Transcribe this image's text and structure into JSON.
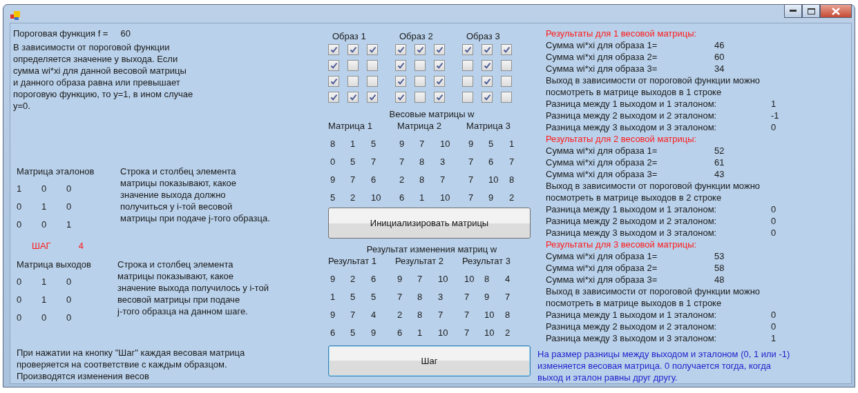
{
  "threshold": {
    "label": "Пороговая функция f =",
    "value": "60"
  },
  "threshold_note": "В зависимости от пороговой функции\nопределяется значение y выхода. Если\nсумма wi*xi для данной весовой матрицы\nи данного образа равна или превышает\nпороговую функцию, то y=1, в ином случае\ny=0.",
  "etalons": {
    "title": "Матрица эталонов",
    "rows": [
      [
        "1",
        "0",
        "0"
      ],
      [
        "0",
        "1",
        "0"
      ],
      [
        "0",
        "0",
        "1"
      ]
    ],
    "note": "Строка и столбец элемента\nматрицы показывают, какое\nзначение выхода должно\nполучиться у i-той весовой\nматрицы при подаче j-того образца."
  },
  "step": {
    "label": "ШАГ",
    "value": "4"
  },
  "outputs": {
    "title": "Матрица выходов",
    "rows": [
      [
        "0",
        "1",
        "0"
      ],
      [
        "0",
        "1",
        "0"
      ],
      [
        "0",
        "0",
        "0"
      ]
    ],
    "note": "Строка и столбец элемента\nматрицы показывают, какое\nзначение выхода получилось у i-той\nвесовой матрицы при подаче\nj-того образца на данном шаге."
  },
  "footer_note": "При нажатии на кнопку \"Шаг\" каждая весовая матрица\nпроверяется на соответствие с каждым образцом.\nПроизводятся изменения весов",
  "images": [
    {
      "title": "Образ 1",
      "cells": [
        [
          true,
          true,
          true
        ],
        [
          true,
          false,
          false
        ],
        [
          true,
          false,
          false
        ],
        [
          true,
          true,
          true
        ]
      ]
    },
    {
      "title": "Образ 2",
      "cells": [
        [
          true,
          true,
          true
        ],
        [
          true,
          false,
          true
        ],
        [
          true,
          false,
          true
        ],
        [
          true,
          false,
          true
        ]
      ]
    },
    {
      "title": "Образ 3",
      "cells": [
        [
          true,
          true,
          true
        ],
        [
          false,
          true,
          false
        ],
        [
          false,
          true,
          false
        ],
        [
          false,
          true,
          false
        ]
      ]
    }
  ],
  "weights": {
    "title": "Весовые матрицы w",
    "matrices": [
      {
        "title": "Матрица 1",
        "rows": [
          [
            "8",
            "1",
            "5"
          ],
          [
            "0",
            "5",
            "7"
          ],
          [
            "9",
            "7",
            "6"
          ],
          [
            "5",
            "2",
            "10"
          ]
        ]
      },
      {
        "title": "Матрица 2",
        "rows": [
          [
            "9",
            "7",
            "10"
          ],
          [
            "7",
            "8",
            "3"
          ],
          [
            "2",
            "8",
            "7"
          ],
          [
            "6",
            "1",
            "10"
          ]
        ]
      },
      {
        "title": "Матрица 3",
        "rows": [
          [
            "9",
            "5",
            "1"
          ],
          [
            "7",
            "6",
            "7"
          ],
          [
            "7",
            "10",
            "8"
          ],
          [
            "7",
            "9",
            "2"
          ]
        ]
      }
    ]
  },
  "init_button": "Инициализировать матрицы",
  "results": {
    "title": "Результат изменения матриц w",
    "matrices": [
      {
        "title": "Результат 1",
        "rows": [
          [
            "9",
            "2",
            "6"
          ],
          [
            "1",
            "5",
            "5"
          ],
          [
            "9",
            "7",
            "4"
          ],
          [
            "6",
            "5",
            "9"
          ]
        ]
      },
      {
        "title": "Результат 2",
        "rows": [
          [
            "9",
            "7",
            "10"
          ],
          [
            "7",
            "8",
            "3"
          ],
          [
            "2",
            "8",
            "7"
          ],
          [
            "6",
            "1",
            "10"
          ]
        ]
      },
      {
        "title": "Результат 3",
        "rows": [
          [
            "10",
            "8",
            "4"
          ],
          [
            "7",
            "9",
            "7"
          ],
          [
            "7",
            "10",
            "8"
          ],
          [
            "7",
            "10",
            "2"
          ]
        ]
      }
    ]
  },
  "step_button": "Шаг",
  "reports": [
    {
      "heading": "Результаты для 1 весовой матрицы:",
      "sums": [
        {
          "label": "Сумма wi*xi для образа 1=",
          "value": "46"
        },
        {
          "label": "Сумма wi*xi для образа 2=",
          "value": "60"
        },
        {
          "label": "Сумма wi*xi для образа 3=",
          "value": "34"
        }
      ],
      "output_note": "Выход в зависимости от пороговой функции можно\nпосмотреть в матрице выходов в 1 строке",
      "diffs": [
        {
          "label": "Разница между 1 выходом и 1 эталоном:",
          "value": "1"
        },
        {
          "label": "Разница между 2 выходом и 2 эталоном:",
          "value": "-1"
        },
        {
          "label": "Разница между 3 выходом и 3 эталоном:",
          "value": "0"
        }
      ]
    },
    {
      "heading": "Результаты для 2 весовой матрицы:",
      "sums": [
        {
          "label": "Сумма wi*xi для образа 1=",
          "value": "52"
        },
        {
          "label": "Сумма wi*xi для образа 2=",
          "value": "61"
        },
        {
          "label": "Сумма wi*xi для образа 3=",
          "value": "43"
        }
      ],
      "output_note": "Выход в зависимости от пороговой функции можно\nпосмотреть в матрице выходов в 2 строке",
      "diffs": [
        {
          "label": "Разница между 1 выходом и 1 эталоном:",
          "value": "0"
        },
        {
          "label": "Разница между 2 выходом и 2 эталоном:",
          "value": "0"
        },
        {
          "label": "Разница между 3 выходом и 3 эталоном:",
          "value": "0"
        }
      ]
    },
    {
      "heading": "Результаты для 3 весовой матрицы:",
      "sums": [
        {
          "label": "Сумма wi*xi для образа 1=",
          "value": "53"
        },
        {
          "label": "Сумма wi*xi для образа 2=",
          "value": "58"
        },
        {
          "label": "Сумма wi*xi для образа 3=",
          "value": "48"
        }
      ],
      "output_note": "Выход в зависимости от пороговой функции можно\nпосмотреть в матрице выходов в 1 строке",
      "diffs": [
        {
          "label": "Разница между 1 выходом и 1 эталоном:",
          "value": "0"
        },
        {
          "label": "Разница между 2 выходом и 2 эталоном:",
          "value": "0"
        },
        {
          "label": "Разница между 3 выходом и 3 эталоном:",
          "value": "1"
        }
      ]
    }
  ],
  "note": "На размер разницы между выходом и эталоном (0, 1 или -1)\nизменяется весовая матрица. 0 получается тогда, когда\nвыход и эталон равны друг другу."
}
